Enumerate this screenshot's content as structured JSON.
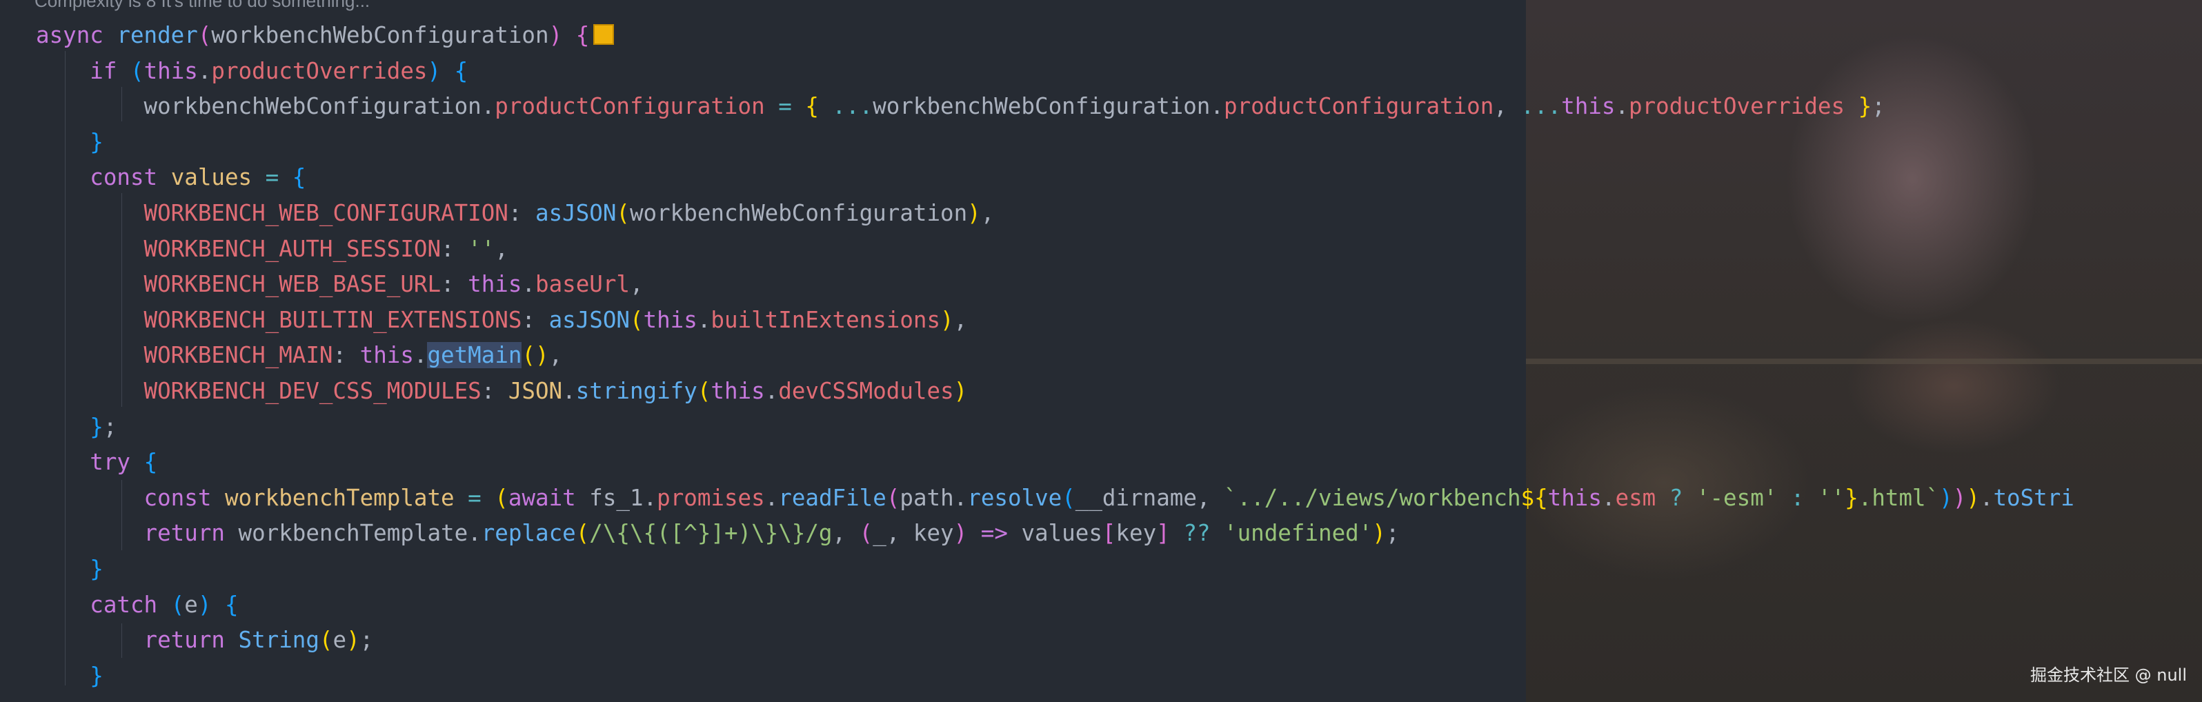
{
  "codelens": "Complexity is 8 It's time to do something...",
  "watermark": "掘金技术社区 @ null",
  "t": {
    "async": "async ",
    "render": "render",
    "p_open": "(",
    "p_close": ")",
    "brace_open": "{",
    "brace_close": "}",
    "wwc": "workbenchWebConfiguration",
    "if": "if ",
    "this": "this",
    "dot": ".",
    "productOverrides": "productOverrides",
    "productConfiguration": "productConfiguration",
    "eq": " = ",
    "spread": "...",
    "comma_sp": ", ",
    "semi": ";",
    "const": "const ",
    "values": "values",
    "k1": "WORKBENCH_WEB_CONFIGURATION",
    "k2": "WORKBENCH_AUTH_SESSION",
    "k3": "WORKBENCH_WEB_BASE_URL",
    "k4": "WORKBENCH_BUILTIN_EXTENSIONS",
    "k5": "WORKBENCH_MAIN",
    "k6": "WORKBENCH_DEV_CSS_MODULES",
    "colon": ": ",
    "asJSON": "asJSON",
    "empty_str": "''",
    "baseUrl": "baseUrl",
    "builtInExtensions": "builtInExtensions",
    "getMain": "getMain",
    "JSON": "JSON",
    "stringify": "stringify",
    "devCSSModules": "devCSSModules",
    "try": "try ",
    "workbenchTemplate": "workbenchTemplate",
    "await": "await ",
    "fs_1": "fs_1",
    "promises": "promises",
    "readFile": "readFile",
    "path": "path",
    "resolve": "resolve",
    "dirname": "__dirname",
    "tpl_start": "`../../views/workbench",
    "dollar_brace": "${",
    "esm": "esm",
    "q": " ? ",
    "esm_str": "'-esm'",
    "c": " : ",
    "tpl_end": ".html`",
    "toStri": "toStri",
    "return": "return ",
    "replace": "replace",
    "regex": "/\\{\\{([^}]+)\\}\\}/g",
    "underscore": "_",
    "key": "key",
    "arrow": " => ",
    "sq_open": "[",
    "sq_close": "]",
    "nullish": " ?? ",
    "undefined_str": "'undefined'",
    "catch": "catch ",
    "e": "e",
    "String": "String"
  }
}
